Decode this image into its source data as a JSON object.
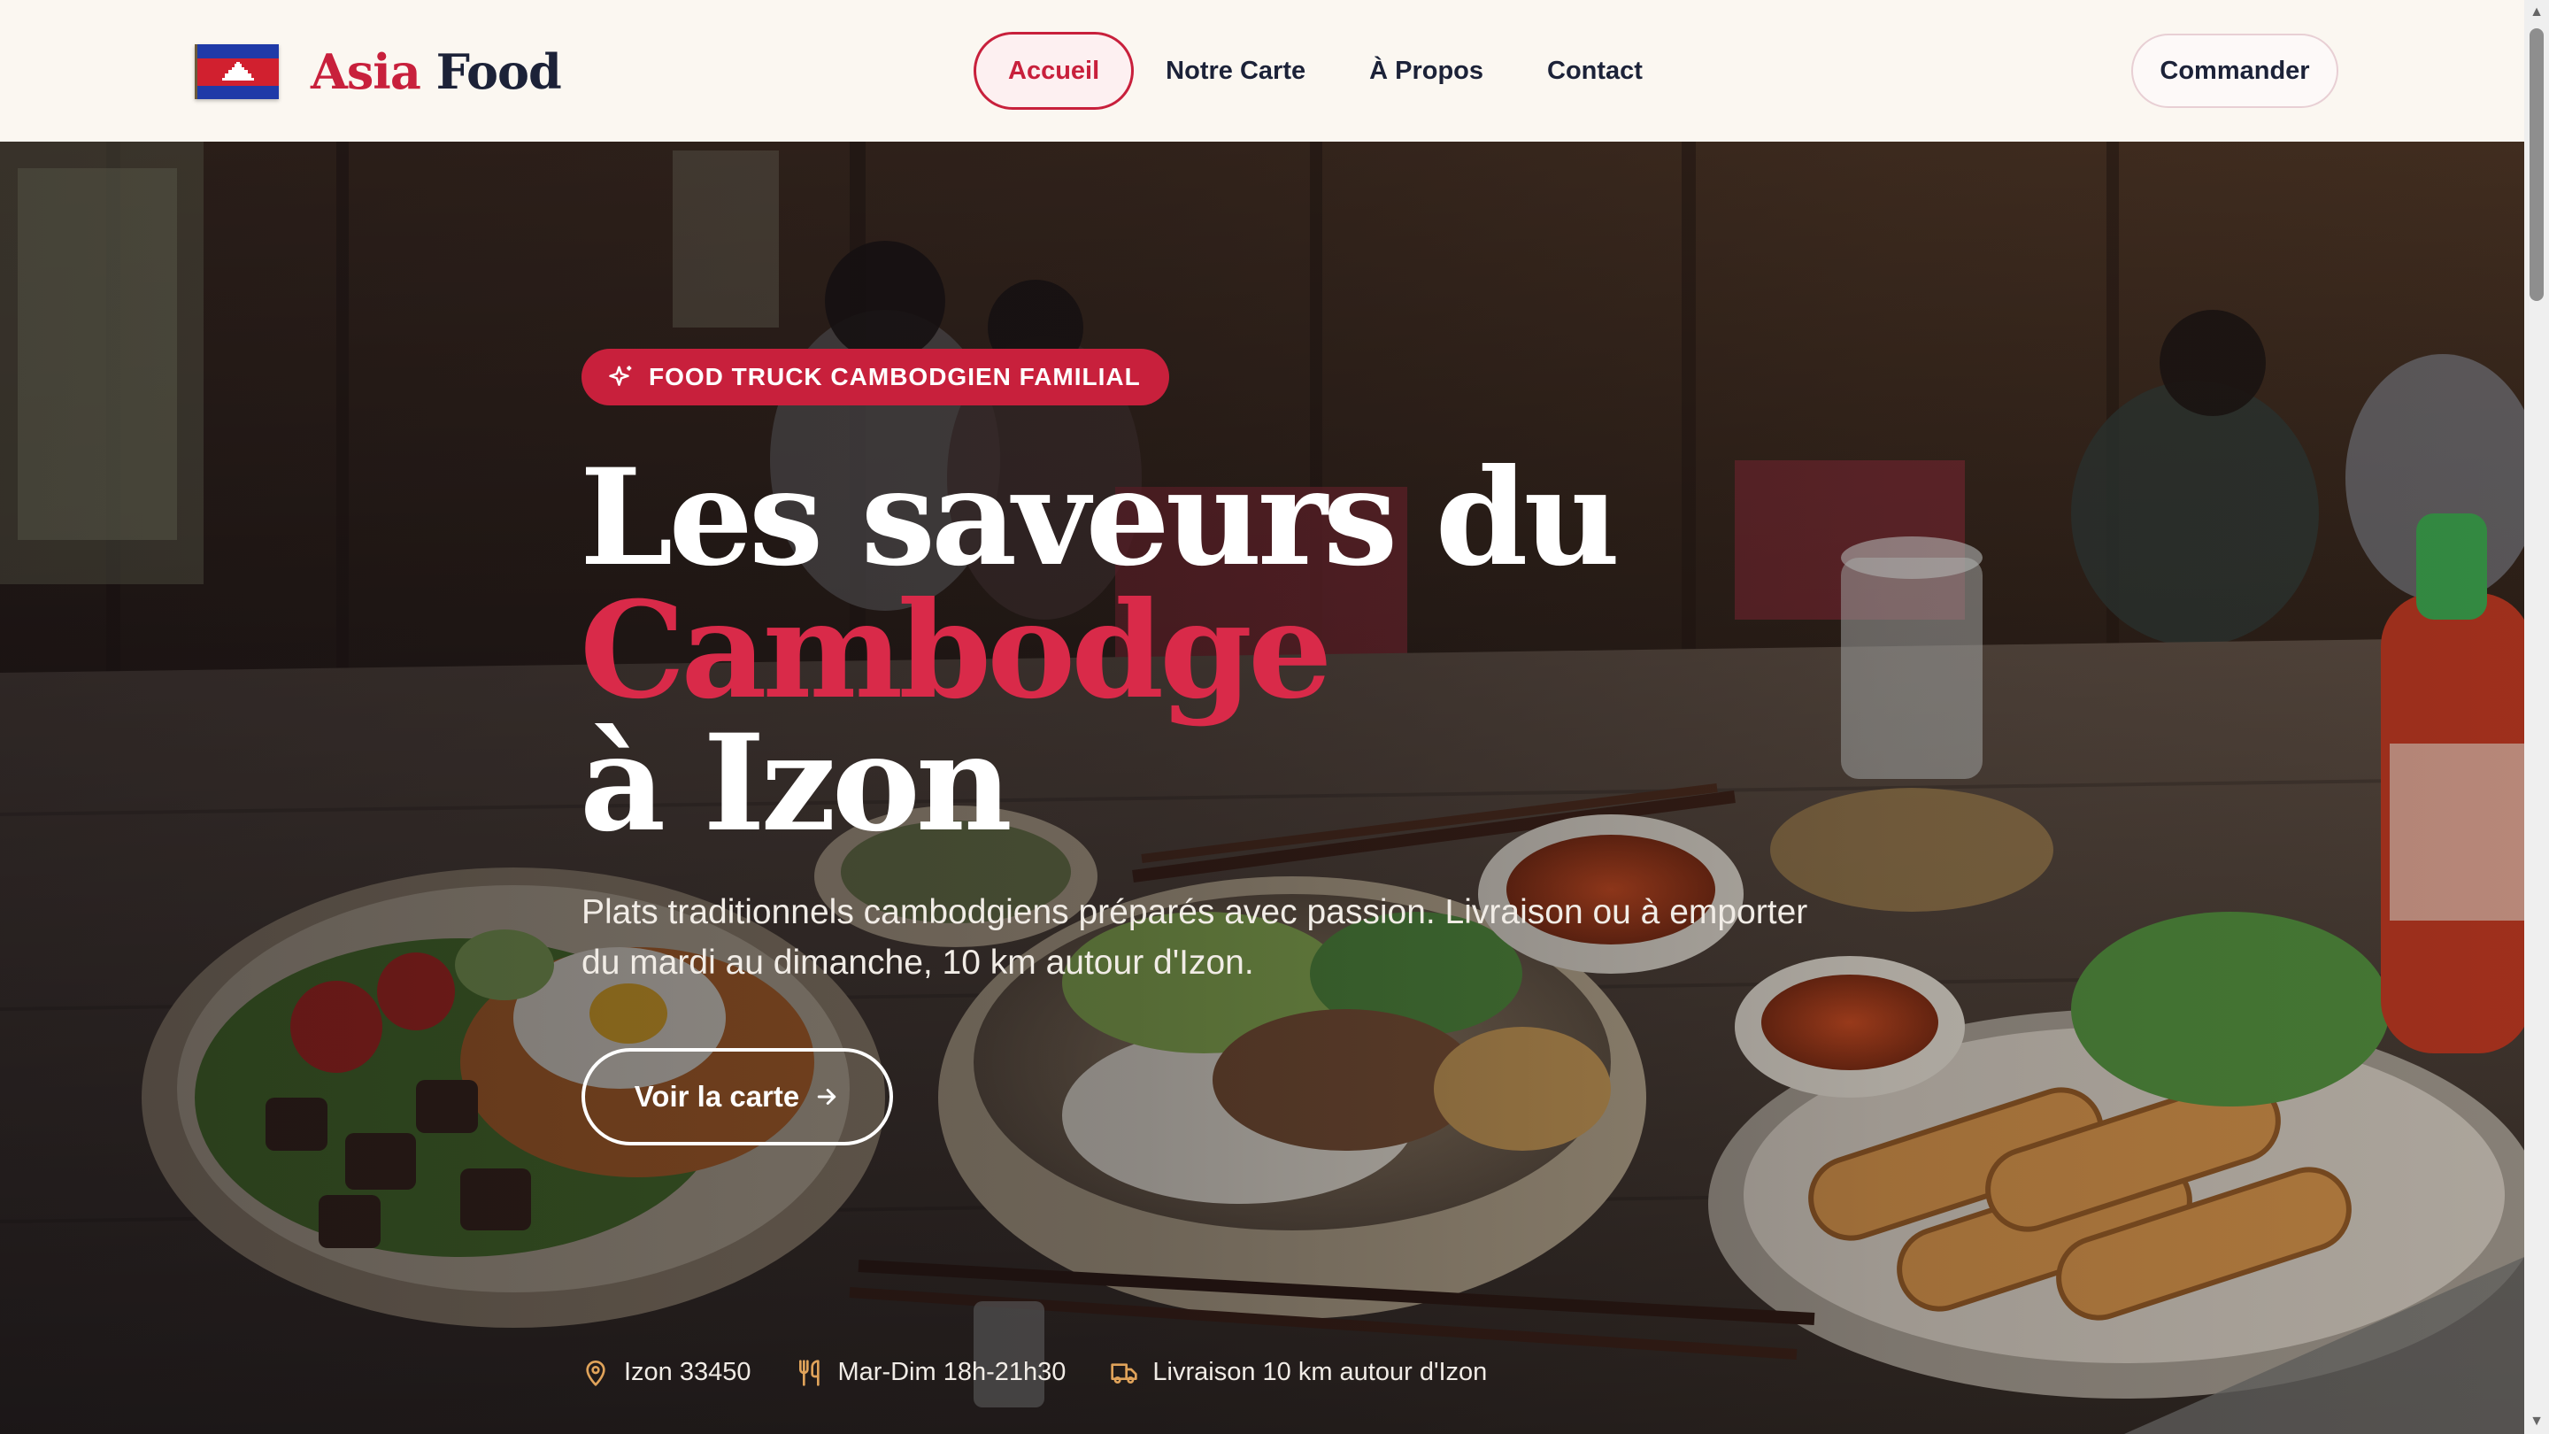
{
  "header": {
    "logo": {
      "word1": "Asia",
      "word2": "Food"
    },
    "nav": [
      {
        "label": "Accueil",
        "active": true
      },
      {
        "label": "Notre Carte"
      },
      {
        "label": "À Propos"
      },
      {
        "label": "Contact"
      }
    ],
    "order_label": "Commander"
  },
  "hero": {
    "badge": "FOOD TRUCK CAMBODGIEN FAMILIAL",
    "title_line1": "Les saveurs du",
    "title_line2": "Cambodge",
    "title_line3": "à Izon",
    "subtitle": "Plats traditionnels cambodgiens préparés avec passion. Livraison ou à emporter du mardi au dimanche, 10 km autour d'Izon.",
    "cta_label": "Voir la carte",
    "infos": [
      {
        "icon": "map-pin-icon",
        "text": "Izon 33450"
      },
      {
        "icon": "utensils-icon",
        "text": "Mar-Dim 18h-21h30"
      },
      {
        "icon": "truck-icon",
        "text": "Livraison 10 km autour d'Izon"
      }
    ]
  },
  "colors": {
    "accent": "#c8203c",
    "navy": "#1c2238",
    "header_bg": "#fbf7f1",
    "icon_gold": "#e0a35a"
  }
}
